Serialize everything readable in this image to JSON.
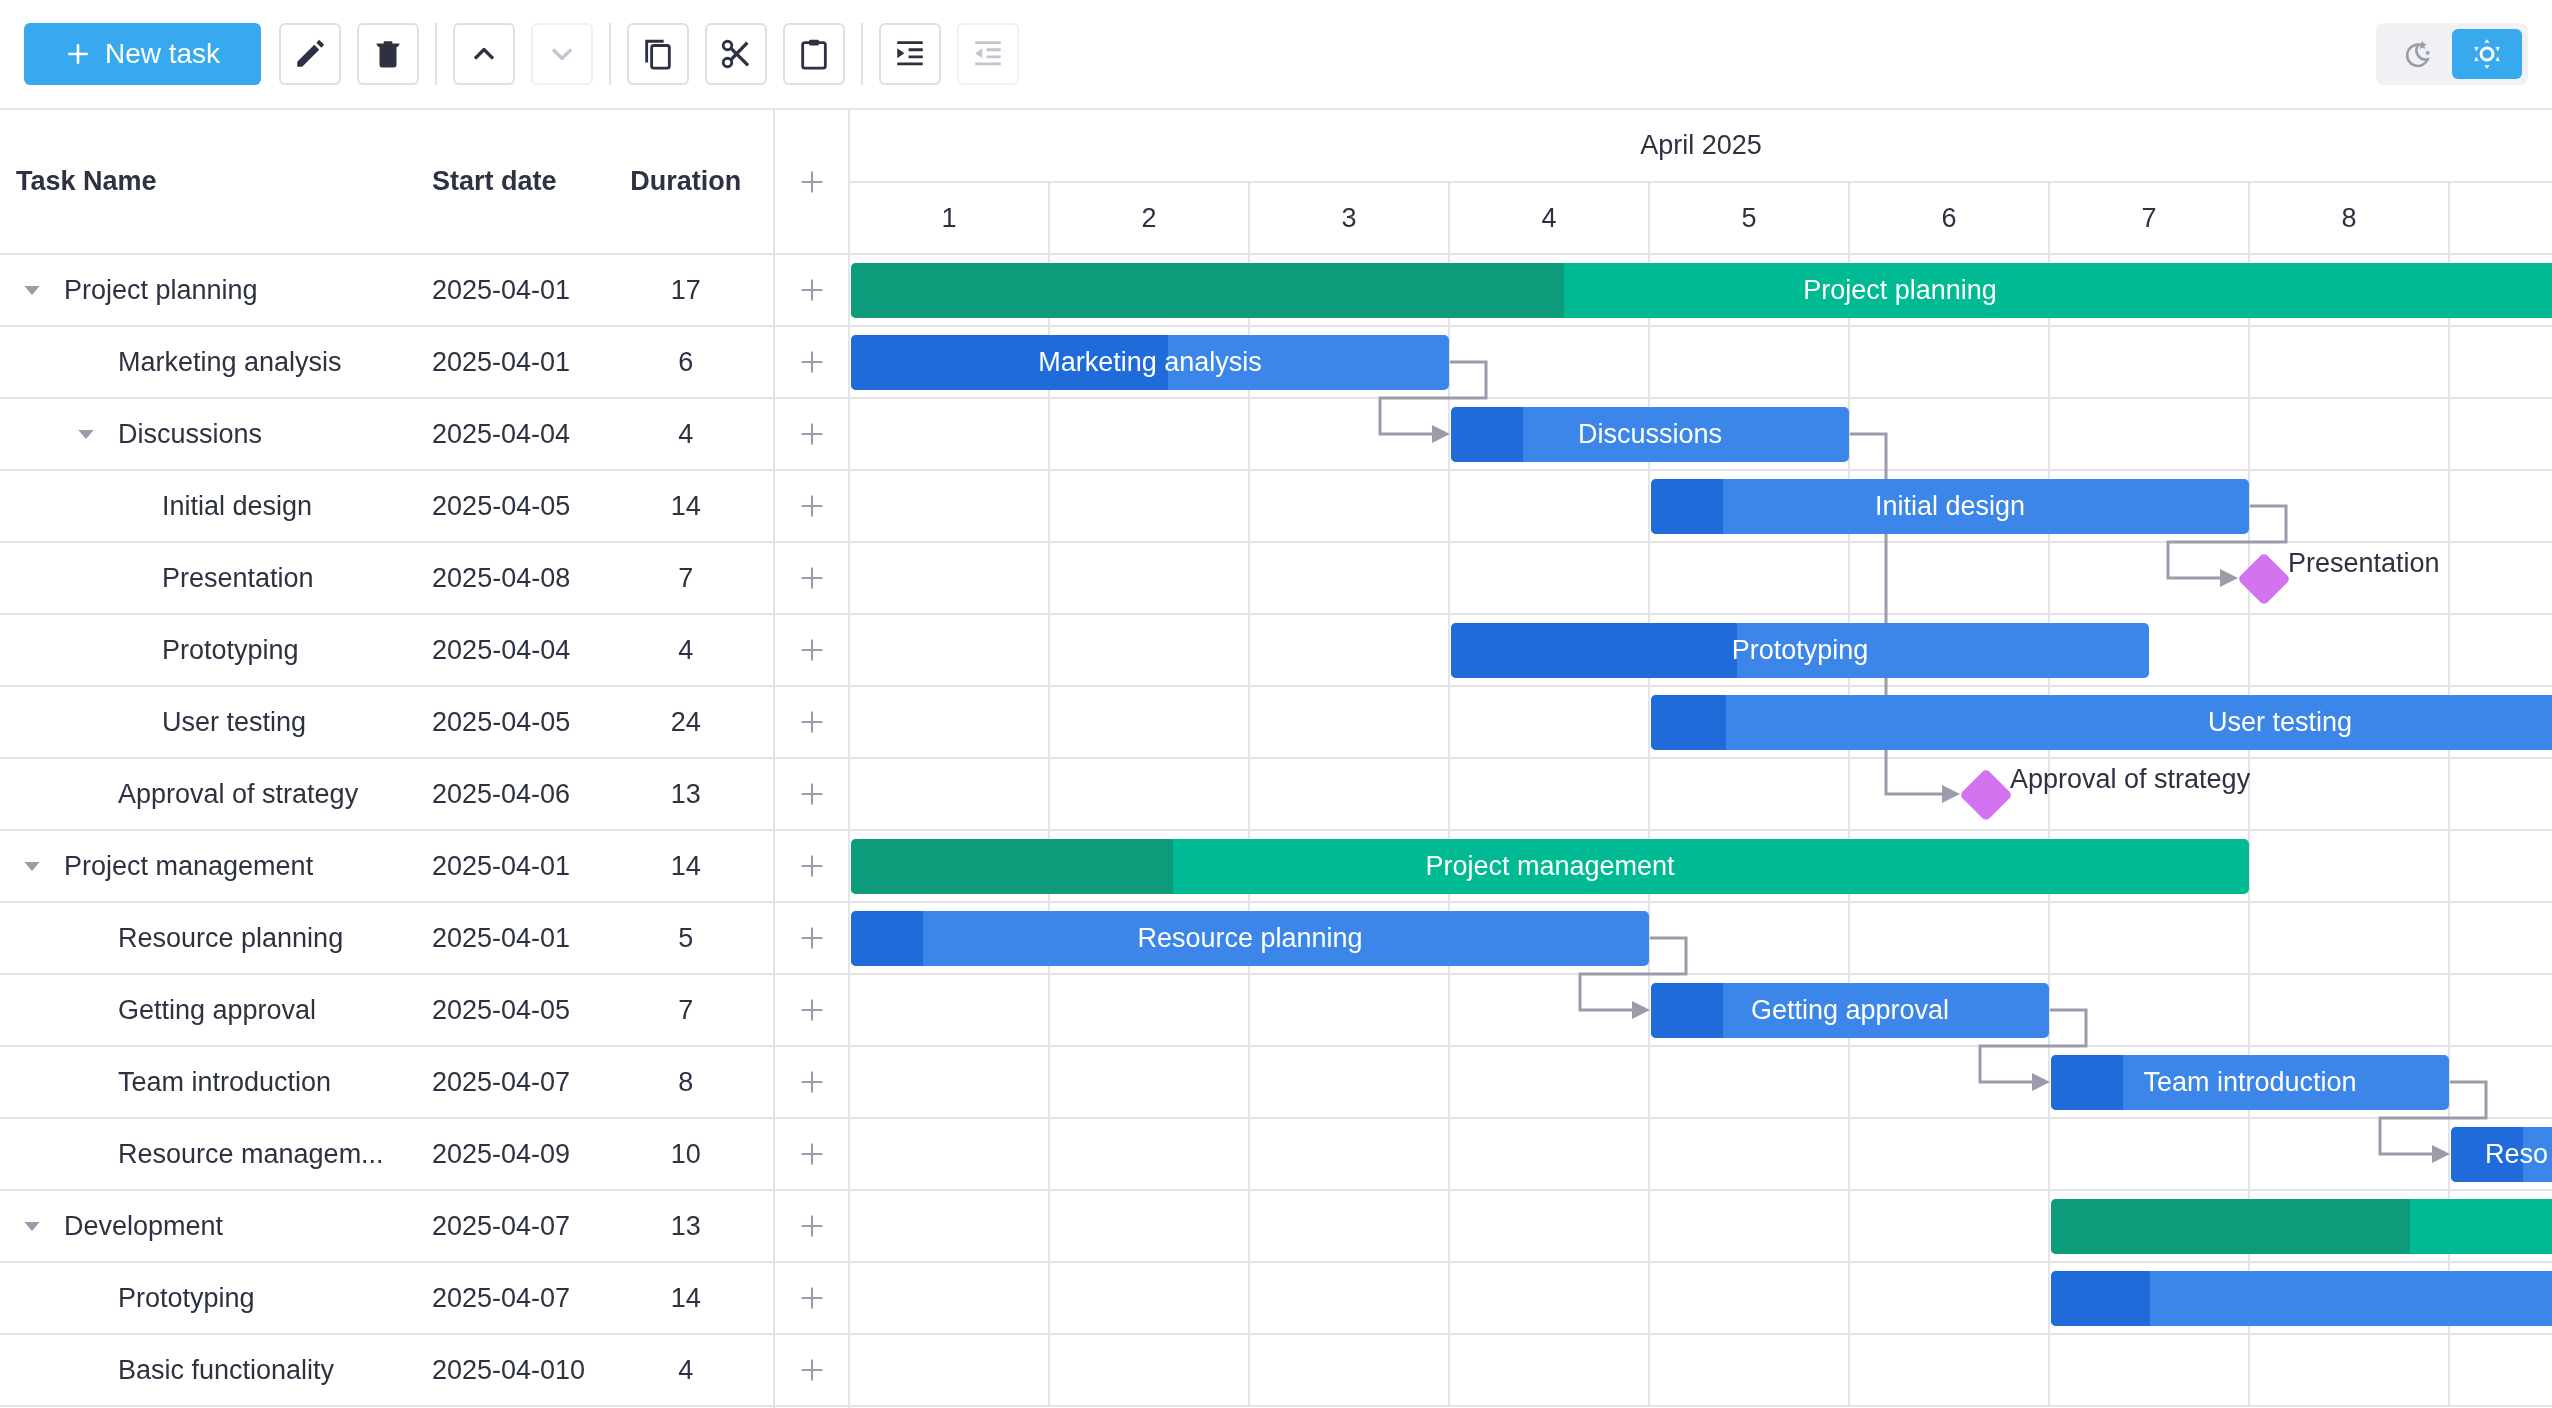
{
  "toolbar": {
    "new_task": "New task",
    "groups": [
      [
        {
          "kind": "edit",
          "disabled": false
        },
        {
          "kind": "delete",
          "disabled": false
        }
      ],
      [
        {
          "kind": "move-up",
          "disabled": false
        },
        {
          "kind": "move-down",
          "disabled": true
        }
      ],
      [
        {
          "kind": "copy",
          "disabled": false
        },
        {
          "kind": "cut",
          "disabled": false
        },
        {
          "kind": "paste",
          "disabled": false
        }
      ],
      [
        {
          "kind": "indent",
          "disabled": false
        },
        {
          "kind": "outdent",
          "disabled": true
        }
      ]
    ],
    "theme": [
      {
        "kind": "dark",
        "selected": false
      },
      {
        "kind": "light",
        "selected": true
      }
    ]
  },
  "grid": {
    "columns": [
      "Task Name",
      "Start date",
      "Duration"
    ]
  },
  "timeline": {
    "month": "April 2025",
    "days": [
      "1",
      "2",
      "3",
      "4",
      "5",
      "6",
      "7",
      "8"
    ]
  },
  "tasks": [
    {
      "name": "Project planning",
      "start": "2025-04-01",
      "duration": "17",
      "kind": "summary",
      "expanded": true,
      "bar": {
        "label": "Project planning",
        "level": 0.34
      },
      "children": [
        {
          "name": "Marketing analysis",
          "start": "2025-04-01",
          "duration": "6",
          "kind": "task",
          "bar": {
            "label": "Marketing analysis",
            "level": 0.53
          }
        },
        {
          "name": "Discussions",
          "start": "2025-04-04",
          "duration": "4",
          "kind": "task",
          "expanded": true,
          "bar": {
            "label": "Discussions",
            "level": 0.18
          },
          "children": [
            {
              "name": "Initial design",
              "start": "2025-04-05",
              "duration": "14",
              "kind": "task",
              "bar": {
                "label": "Initial design",
                "level": 0.12
              }
            },
            {
              "name": "Presentation",
              "start": "2025-04-08",
              "duration": "7",
              "kind": "milestone",
              "bar": {
                "label": "Presentation"
              }
            },
            {
              "name": "Prototyping",
              "start": "2025-04-04",
              "duration": "4",
              "kind": "task",
              "bar": {
                "label": "Prototyping",
                "level": 0.41
              }
            },
            {
              "name": "User testing",
              "start": "2025-04-05",
              "duration": "24",
              "kind": "task",
              "bar": {
                "label": "User testing",
                "level": 0.06
              }
            }
          ]
        },
        {
          "name": "Approval of strategy",
          "start": "2025-04-06",
          "duration": "13",
          "kind": "milestone",
          "bar": {
            "label": "Approval of strategy"
          }
        }
      ]
    },
    {
      "name": "Project management",
      "start": "2025-04-01",
      "duration": "14",
      "kind": "summary",
      "expanded": true,
      "bar": {
        "label": "Project management",
        "level": 0.23
      },
      "children": [
        {
          "name": "Resource planning",
          "start": "2025-04-01",
          "duration": "5",
          "kind": "task",
          "bar": {
            "label": "Resource planning",
            "level": 0.09
          }
        },
        {
          "name": "Getting approval",
          "start": "2025-04-05",
          "duration": "7",
          "kind": "task",
          "bar": {
            "label": "Getting approval",
            "level": 0.18
          }
        },
        {
          "name": "Team introduction",
          "start": "2025-04-07",
          "duration": "8",
          "kind": "task",
          "bar": {
            "label": "Team introduction",
            "level": 0.18
          }
        },
        {
          "name": "Resource managem...",
          "start": "2025-04-09",
          "duration": "10",
          "kind": "task",
          "bar": {
            "label": "Reso",
            "level": 0.18
          }
        }
      ]
    },
    {
      "name": "Development",
      "start": "2025-04-07",
      "duration": "13",
      "kind": "summary",
      "expanded": true,
      "bar": {
        "level": 0.4
      },
      "children": [
        {
          "name": "Prototyping",
          "start": "2025-04-07",
          "duration": "14",
          "kind": "task",
          "bar": {
            "level": 0.11
          }
        },
        {
          "name": "Basic functionality",
          "start": "2025-04-010",
          "duration": "4"
        }
      ]
    }
  ]
}
